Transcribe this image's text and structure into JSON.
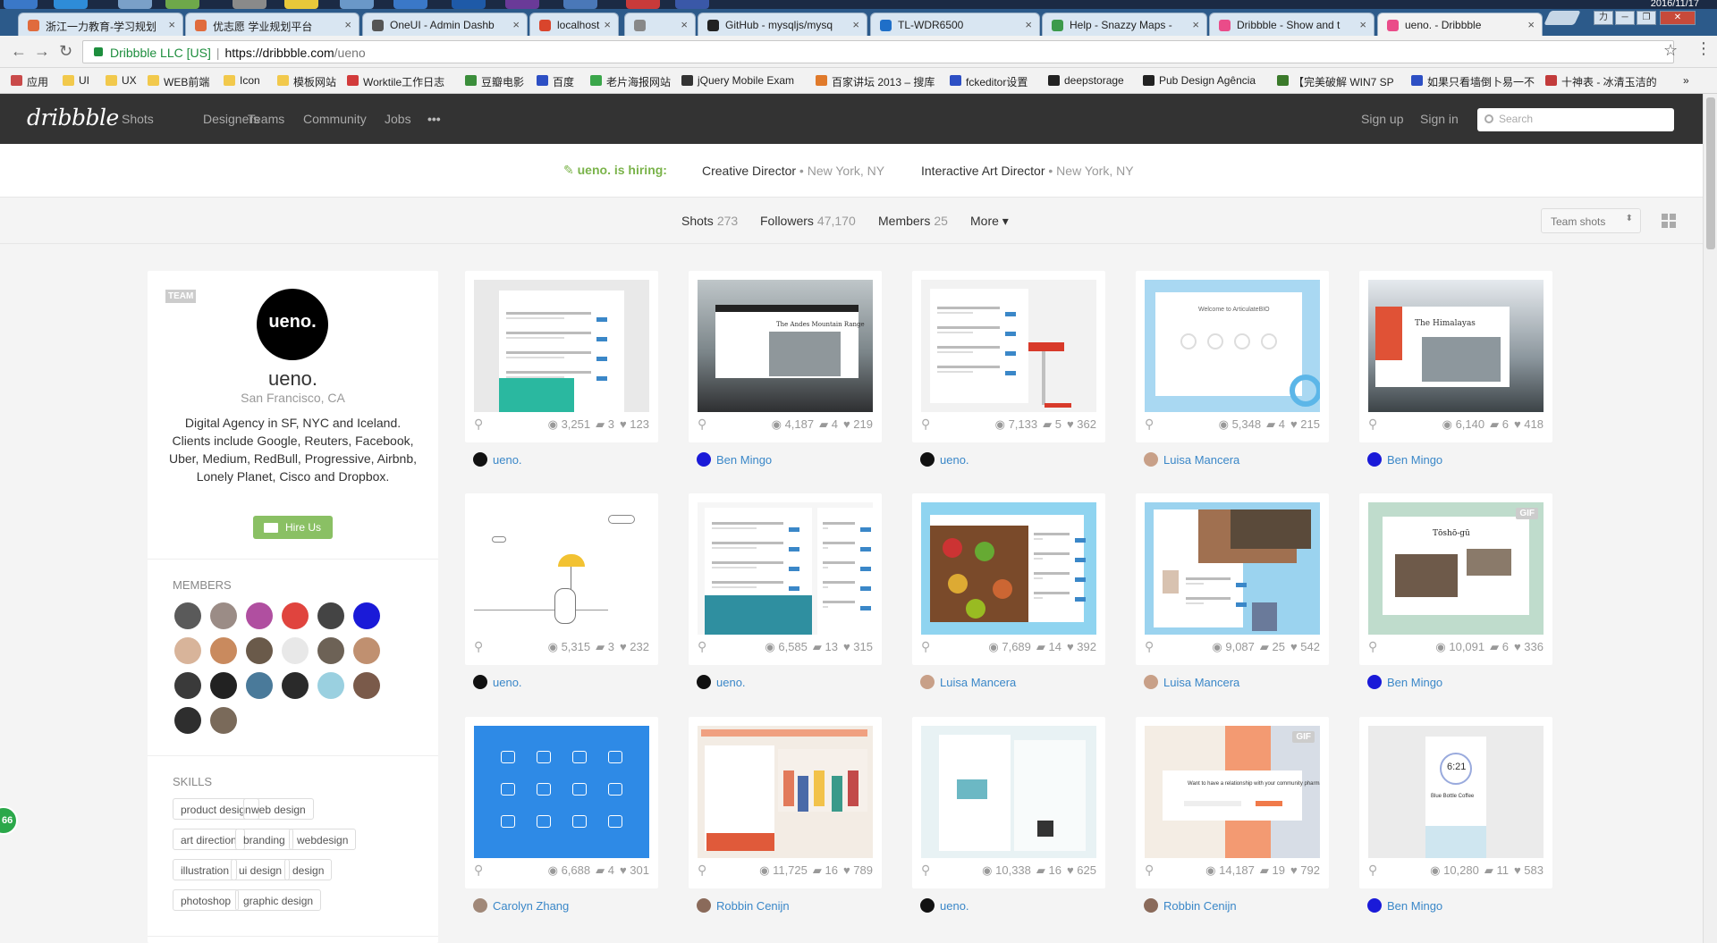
{
  "os": {
    "clock": "2016/11/17"
  },
  "browser": {
    "tabs": [
      {
        "title": "浙江一力教育-学习规划",
        "color": "#e06b3d"
      },
      {
        "title": "优志愿 学业规划平台",
        "color": "#e06b3d"
      },
      {
        "title": "OneUI - Admin Dashb",
        "color": "#555555"
      },
      {
        "title": "localhost",
        "color": "#d9452c"
      },
      {
        "title": "",
        "color": "#888888"
      },
      {
        "title": "GitHub - mysqljs/mysq",
        "color": "#222222"
      },
      {
        "title": "TL-WDR6500",
        "color": "#1f6fc8"
      },
      {
        "title": "Help - Snazzy Maps -",
        "color": "#3c9a4b"
      },
      {
        "title": "Dribbble - Show and t",
        "color": "#ea4c89"
      },
      {
        "title": "ueno. - Dribbble",
        "color": "#ea4c89"
      }
    ],
    "tab_close": "×",
    "url": {
      "org": "Dribbble LLC [US]",
      "sep": "|",
      "host": "https://dribbble.com",
      "path": "/ueno"
    },
    "star_icon": "☆",
    "menu_icon": "⋮",
    "back": "←",
    "forward": "→",
    "reload": "↻",
    "window_controls": [
      "力",
      "─",
      "❐",
      "✕"
    ],
    "bookmarks": [
      {
        "label": "应用",
        "color": "#c94a4a"
      },
      {
        "label": "UI",
        "color": "#f2c94c"
      },
      {
        "label": "UX",
        "color": "#f2c94c"
      },
      {
        "label": "WEB前端",
        "color": "#f2c94c"
      },
      {
        "label": "Icon",
        "color": "#f2c94c"
      },
      {
        "label": "模板网站",
        "color": "#f2c94c"
      },
      {
        "label": "Worktile工作日志",
        "color": "#d23b3b"
      },
      {
        "label": "豆瓣电影",
        "color": "#3b8e3b"
      },
      {
        "label": "百度",
        "color": "#2d4fc4"
      },
      {
        "label": "老片海报网站",
        "color": "#3aa64a"
      },
      {
        "label": "jQuery Mobile Exam",
        "color": "#333333"
      },
      {
        "label": "百家讲坛 2013 – 搜库",
        "color": "#e07a2b"
      },
      {
        "label": "fckeditor设置",
        "color": "#2d4fc4"
      },
      {
        "label": "deepstorage",
        "color": "#222222"
      },
      {
        "label": "Pub Design Agência",
        "color": "#222222"
      },
      {
        "label": "【完美破解 WIN7 SP",
        "color": "#3b7a2b"
      },
      {
        "label": "如果只看墙倒卜易一不",
        "color": "#2d4fc4"
      },
      {
        "label": "十神表 - 冰清玉洁的",
        "color": "#c23b3b"
      }
    ],
    "bookmarks_more": "»"
  },
  "dribbble": {
    "logo": "dribbble",
    "nav": [
      "Shots",
      "Designers",
      "Teams",
      "Community",
      "Jobs",
      "•••"
    ],
    "signup": "Sign up",
    "signin": "Sign in",
    "search_placeholder": "Search"
  },
  "hiring": {
    "lead": "ueno. is hiring:",
    "jobs": [
      {
        "title": "Creative Director",
        "loc": " • New York, NY"
      },
      {
        "title": "Interactive Art Director",
        "loc": " • New York, NY"
      }
    ]
  },
  "stats": {
    "shots": {
      "label": "Shots",
      "count": "273"
    },
    "followers": {
      "label": "Followers",
      "count": "47,170"
    },
    "members": {
      "label": "Members",
      "count": "25"
    },
    "more": "More ▾",
    "team_shots": "Team shots",
    "team_shots_arrow": "⬍"
  },
  "profile": {
    "badge": "TEAM",
    "logo_text": "ueno.",
    "name": "ueno.",
    "location": "San Francisco, CA",
    "bio": "Digital Agency in SF, NYC and Iceland. Clients include Google, Reuters, Facebook, Uber, Medium, RedBull, Progressive, Airbnb, Lonely Planet, Cisco and Dropbox.",
    "hire_label": "Hire Us",
    "members_title": "Members",
    "skills_title": "Skills",
    "member_colors": [
      "#5a5a5a",
      "#9b8c86",
      "#b04fa0",
      "#e0443e",
      "#444444",
      "#1a1ad8",
      "#d8b49a",
      "#c98a5e",
      "#6a5a4a",
      "#e8e8e8",
      "#6d6256",
      "#c09070",
      "#3a3a3a",
      "#222222",
      "#4a7a9a",
      "#2a2a2a",
      "#9ad0e0",
      "#7a5a4a",
      "#2e2e2e",
      "#7a6a5a"
    ],
    "skills": [
      "product design",
      "web design",
      "art direction",
      "branding",
      "webdesign",
      "illustration",
      "ui design",
      "design",
      "photoshop",
      "graphic design"
    ]
  },
  "shots": [
    {
      "views": "3,251",
      "comments": "3",
      "likes": "123",
      "author": "ueno.",
      "author_color": "#111111",
      "gif": false,
      "style": "web-teal"
    },
    {
      "views": "4,187",
      "comments": "4",
      "likes": "219",
      "author": "Ben Mingo",
      "author_color": "#1a1ad8",
      "gif": false,
      "style": "mountain"
    },
    {
      "views": "7,133",
      "comments": "5",
      "likes": "362",
      "author": "ueno.",
      "author_color": "#111111",
      "gif": false,
      "style": "web-umbrella"
    },
    {
      "views": "5,348",
      "comments": "4",
      "likes": "215",
      "author": "Luisa Mancera",
      "author_color": "#c8a088",
      "gif": false,
      "style": "lightblue"
    },
    {
      "views": "6,140",
      "comments": "6",
      "likes": "418",
      "author": "Ben Mingo",
      "author_color": "#1a1ad8",
      "gif": false,
      "style": "himalaya"
    },
    {
      "views": "5,315",
      "comments": "3",
      "likes": "232",
      "author": "ueno.",
      "author_color": "#111111",
      "gif": false,
      "style": "illustration"
    },
    {
      "views": "6,585",
      "comments": "13",
      "likes": "315",
      "author": "ueno.",
      "author_color": "#111111",
      "gif": false,
      "style": "web-photo"
    },
    {
      "views": "7,689",
      "comments": "14",
      "likes": "392",
      "author": "Luisa Mancera",
      "author_color": "#c8a088",
      "gif": false,
      "style": "food"
    },
    {
      "views": "9,087",
      "comments": "25",
      "likes": "542",
      "author": "Luisa Mancera",
      "author_color": "#c8a088",
      "gif": false,
      "style": "people"
    },
    {
      "views": "10,091",
      "comments": "6",
      "likes": "336",
      "author": "Ben Mingo",
      "author_color": "#1a1ad8",
      "gif": true,
      "style": "tosho"
    },
    {
      "views": "6,688",
      "comments": "4",
      "likes": "301",
      "author": "Carolyn Zhang",
      "author_color": "#a08878",
      "gif": false,
      "style": "icons-blue"
    },
    {
      "views": "11,725",
      "comments": "16",
      "likes": "789",
      "author": "Robbin Cenijn",
      "author_color": "#8a6a5a",
      "gif": false,
      "style": "orange-web"
    },
    {
      "views": "10,338",
      "comments": "16",
      "likes": "625",
      "author": "ueno.",
      "author_color": "#111111",
      "gif": false,
      "style": "cards"
    },
    {
      "views": "14,187",
      "comments": "19",
      "likes": "792",
      "author": "Robbin Cenijn",
      "author_color": "#8a6a5a",
      "gif": true,
      "style": "pharmacist"
    },
    {
      "views": "10,280",
      "comments": "11",
      "likes": "583",
      "author": "Ben Mingo",
      "author_color": "#1a1ad8",
      "gif": false,
      "style": "phone"
    }
  ],
  "shot_gif_label": "GIF",
  "thumb_text": {
    "andes": "The Andes Mountain Range",
    "himalayas": "The Himalayas",
    "welcome": "Welcome to ArticulateBIO",
    "tosho": "Tōshō-gū",
    "pharm": "Want to have a relationship with your community pharmacist?",
    "phone": "6:21",
    "phone_sub": "Blue Bottle Coffee"
  },
  "badge": "66"
}
